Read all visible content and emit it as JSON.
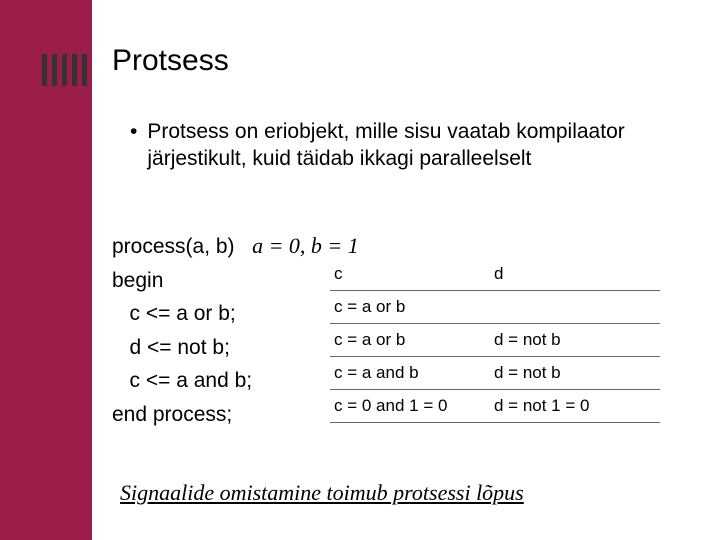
{
  "title": "Protsess",
  "bullet": "Protsess on eriobjekt, mille sisu vaatab kompilaator järjestikult, kuid täidab ikkagi paralleelselt",
  "code": {
    "l1a": "process(a, b)   ",
    "l1b": "a = 0, b = 1",
    "l2": "begin",
    "l3": "   c <= a or b;",
    "l4": "   d <= not b;",
    "l5": "   c <= a and b;",
    "l6": "end process;"
  },
  "table": {
    "h1": "c",
    "h2": "d",
    "r1c1": "c = a or b",
    "r1c2": "",
    "r2c1": "c = a or b",
    "r2c2": "d = not b",
    "r3c1": "c = a and b",
    "r3c2": "d = not b",
    "r4c1": "c = 0 and 1 = 0",
    "r4c2": "d = not 1 = 0"
  },
  "footer": "Signaalide omistamine toimub protsessi lõpus"
}
